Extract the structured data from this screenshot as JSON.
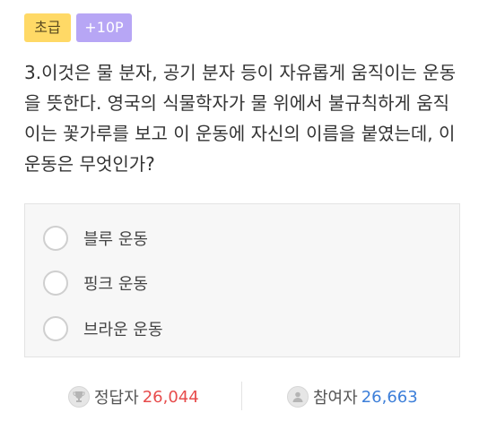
{
  "badges": {
    "level": "초급",
    "points": "+10P"
  },
  "question": "3.이것은 물 분자, 공기 분자 등이 자유롭게 움직이는 운동을 뜻한다. 영국의 식물학자가 물 위에서 불규칙하게 움직이는 꽃가루를 보고 이 운동에 자신의 이름을 붙였는데, 이 운동은 무엇인가?",
  "options": [
    {
      "label": "블루 운동"
    },
    {
      "label": "핑크 운동"
    },
    {
      "label": "브라운 운동"
    }
  ],
  "stats": {
    "correct_label": "정답자",
    "correct_count": "26,044",
    "participants_label": "참여자",
    "participants_count": "26,663",
    "correct_icon": "trophy-icon",
    "participants_icon": "user-icon"
  },
  "colors": {
    "level_badge": "#ffd966",
    "points_badge": "#b7a6f5",
    "correct_count": "#e74c4c",
    "participants_count": "#3d7fd9"
  }
}
